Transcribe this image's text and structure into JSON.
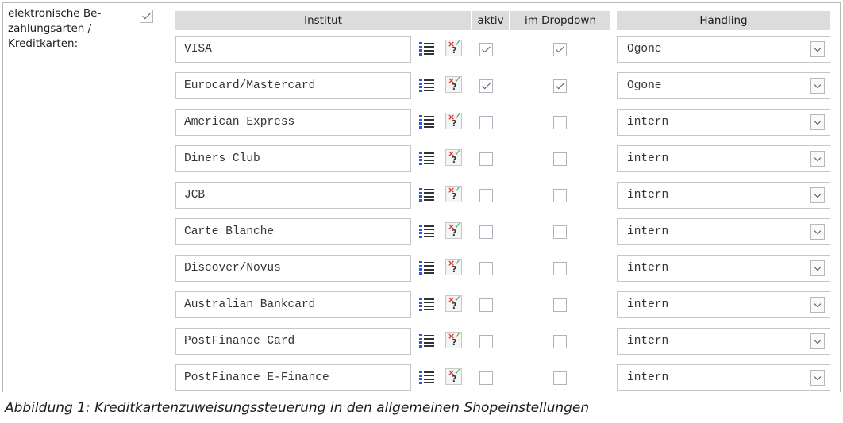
{
  "section": {
    "label_lines": [
      "elektronische Be-",
      "zahlungsarten /",
      "Kreditkarten:"
    ],
    "enabled": true
  },
  "headers": {
    "institut": "Institut",
    "aktiv": "aktiv",
    "dropdown": "im Dropdown",
    "handling": "Handling"
  },
  "rows": [
    {
      "institut": "VISA",
      "aktiv": true,
      "dropdown": true,
      "handling": "Ogone"
    },
    {
      "institut": "Eurocard/Mastercard",
      "aktiv": true,
      "dropdown": true,
      "handling": "Ogone"
    },
    {
      "institut": "American Express",
      "aktiv": false,
      "dropdown": false,
      "handling": "intern"
    },
    {
      "institut": "Diners Club",
      "aktiv": false,
      "dropdown": false,
      "handling": "intern"
    },
    {
      "institut": "JCB",
      "aktiv": false,
      "dropdown": false,
      "handling": "intern"
    },
    {
      "institut": "Carte Blanche",
      "aktiv": false,
      "dropdown": false,
      "handling": "intern"
    },
    {
      "institut": "Discover/Novus",
      "aktiv": false,
      "dropdown": false,
      "handling": "intern"
    },
    {
      "institut": "Australian Bankcard",
      "aktiv": false,
      "dropdown": false,
      "handling": "intern"
    },
    {
      "institut": "PostFinance Card",
      "aktiv": false,
      "dropdown": false,
      "handling": "intern"
    },
    {
      "institut": "PostFinance E-Finance",
      "aktiv": false,
      "dropdown": false,
      "handling": "intern"
    }
  ],
  "caption": "Abbildung 1: Kreditkartenzuweisungssteuerung in den allgemeinen Shopeinstellungen"
}
